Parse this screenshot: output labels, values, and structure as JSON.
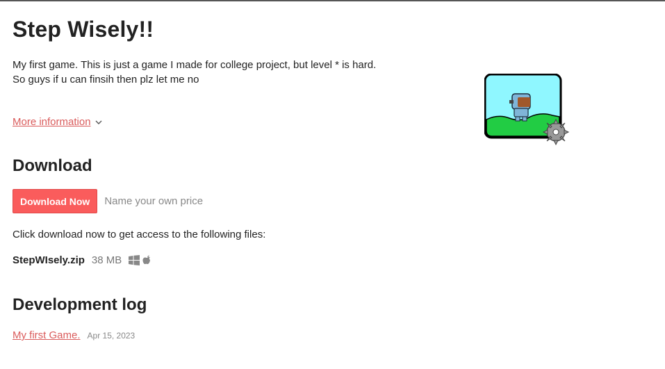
{
  "game": {
    "title": "Step Wisely!!",
    "description_line1": "My first game. This is just a game I made for college project, but level * is hard.",
    "description_line2": "So guys if u can finsih then plz let me no",
    "more_info": "More information"
  },
  "download": {
    "heading": "Download",
    "button_label": "Download Now",
    "price_hint": "Name your own price",
    "files_intro": "Click download now to get access to the following files:",
    "files": [
      {
        "name": "StepWIsely.zip",
        "size": "38 MB",
        "platforms": [
          "windows-icon",
          "apple-icon"
        ]
      }
    ]
  },
  "devlog": {
    "heading": "Development log",
    "entries": [
      {
        "title": "My first Game.",
        "date": "Apr 15, 2023"
      }
    ]
  },
  "colors": {
    "accent": "#fa5c5c",
    "link": "#da5b5b",
    "text": "#222222",
    "muted": "#888888"
  }
}
